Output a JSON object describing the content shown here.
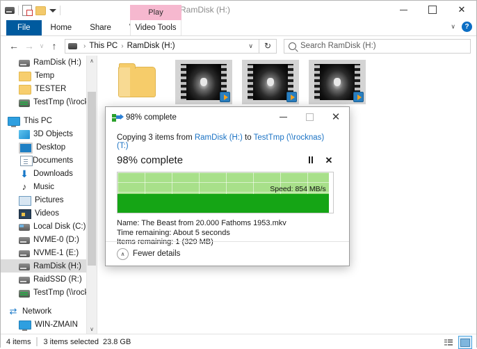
{
  "window": {
    "title": "RamDisk (H:)",
    "quick_access": [
      "drive-icon",
      "properties-icon",
      "new-folder-icon",
      "customize-dropdown"
    ],
    "controls": {
      "minimize": "—",
      "maximize": "□",
      "close": "✕"
    }
  },
  "ribbon": {
    "tabs": [
      {
        "label": "File",
        "active": true
      },
      {
        "label": "Home",
        "active": false
      },
      {
        "label": "Share",
        "active": false
      },
      {
        "label": "View",
        "active": false
      }
    ],
    "contextual": {
      "group": "Video Tools",
      "tab": "Play",
      "color": "#f6b8cf"
    },
    "collapse_label": "∨",
    "help_label": "?"
  },
  "nav": {
    "back": "←",
    "forward": "→",
    "recent": "∨",
    "up": "↑",
    "refresh": "↻",
    "dropdown": "∨",
    "breadcrumbs": [
      "This PC",
      "RamDisk (H:)"
    ],
    "crumb_sep": "›"
  },
  "search": {
    "placeholder": "Search RamDisk (H:)",
    "icon": "search-icon"
  },
  "sidebar": {
    "items": [
      {
        "label": "RamDisk (H:)",
        "icon": "drive",
        "indent": 1,
        "selected": false
      },
      {
        "label": "Temp",
        "icon": "folder",
        "indent": 1,
        "selected": false
      },
      {
        "label": "TESTER",
        "icon": "folder",
        "indent": 1,
        "selected": false
      },
      {
        "label": "TestTmp (\\\\rocknas) (",
        "icon": "net",
        "indent": 1,
        "selected": false
      },
      {
        "label": "",
        "icon": "gap",
        "indent": 0,
        "selected": false
      },
      {
        "label": "This PC",
        "icon": "pc",
        "indent": 0,
        "selected": false
      },
      {
        "label": "3D Objects",
        "icon": "box",
        "indent": 1,
        "selected": false
      },
      {
        "label": "Desktop",
        "icon": "desk",
        "indent": 1,
        "selected": false
      },
      {
        "label": "Documents",
        "icon": "doc",
        "indent": 1,
        "selected": false
      },
      {
        "label": "Downloads",
        "icon": "dl",
        "indent": 1,
        "selected": false
      },
      {
        "label": "Music",
        "icon": "mus",
        "indent": 1,
        "selected": false
      },
      {
        "label": "Pictures",
        "icon": "pic",
        "indent": 1,
        "selected": false
      },
      {
        "label": "Videos",
        "icon": "vid",
        "indent": 1,
        "selected": false
      },
      {
        "label": "Local Disk (C:)",
        "icon": "hdd",
        "indent": 1,
        "selected": false
      },
      {
        "label": "NVME-0 (D:)",
        "icon": "drive",
        "indent": 1,
        "selected": false
      },
      {
        "label": "NVME-1 (E:)",
        "icon": "drive",
        "indent": 1,
        "selected": false
      },
      {
        "label": "RamDisk (H:)",
        "icon": "drive",
        "indent": 1,
        "selected": true
      },
      {
        "label": "RaidSSD (R:)",
        "icon": "drive",
        "indent": 1,
        "selected": false
      },
      {
        "label": "TestTmp (\\\\rocknas) (",
        "icon": "net",
        "indent": 1,
        "selected": false
      },
      {
        "label": "",
        "icon": "gap",
        "indent": 0,
        "selected": false
      },
      {
        "label": "Network",
        "icon": "netw",
        "indent": 0,
        "selected": false
      },
      {
        "label": "WIN-ZMAIN",
        "icon": "pc",
        "indent": 1,
        "selected": false
      }
    ],
    "scroll_up": "∧",
    "scroll_down": "∨"
  },
  "files": [
    {
      "type": "folder",
      "selected": false
    },
    {
      "type": "video",
      "selected": true
    },
    {
      "type": "video",
      "selected": true
    },
    {
      "type": "video",
      "selected": true
    }
  ],
  "status": {
    "item_count": "4 items",
    "selection": "3 items selected",
    "size": "23.8 GB",
    "view_details": "details-view-icon",
    "view_large": "large-icons-view-icon"
  },
  "dialog": {
    "title": "98% complete",
    "icon": "copy-icon",
    "controls": {
      "minimize": "—",
      "maximize": "□",
      "close": "✕"
    },
    "copy_prefix": "Copying 3 items from ",
    "source": "RamDisk (H:)",
    "copy_mid": " to ",
    "destination": "TestTmp (\\\\rocknas) (T:)",
    "percent_label": "98% complete",
    "percent_value": 98,
    "pause_button": "pause-button",
    "cancel_button": "✕",
    "speed_label": "Speed: 854 MB/s",
    "name_label": "Name:",
    "name_value": "The Beast from 20.000 Fathoms 1953.mkv",
    "time_label": "Time remaining:",
    "time_value": "About 5 seconds",
    "items_label": "Items remaining:",
    "items_value": "1 (329 MB)",
    "fewer_details": "Fewer details",
    "fewer_chevron": "∧",
    "progress_color": "#15a515",
    "speed_graph_color": "#a8e08a"
  }
}
